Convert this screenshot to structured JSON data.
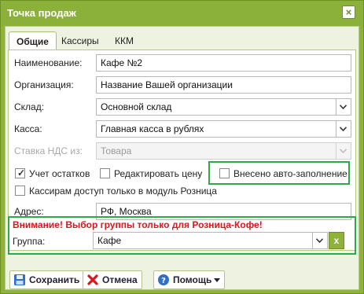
{
  "window": {
    "title": "Точка продаж"
  },
  "tabs": [
    {
      "label": "Общие",
      "active": true
    },
    {
      "label": "Кассиры",
      "active": false
    },
    {
      "label": "ККМ",
      "active": false
    }
  ],
  "form": {
    "name": {
      "label": "Наименование:",
      "value": "Кафе №2"
    },
    "organization": {
      "label": "Организация:",
      "value": "Название Вашей организации"
    },
    "warehouse": {
      "label": "Склад:",
      "value": "Основной склад"
    },
    "cashbox": {
      "label": "Касса:",
      "value": "Главная касса в рублях"
    },
    "vat_source": {
      "label": "Ставка НДС из:",
      "value": "Товара",
      "disabled": true
    },
    "checkboxes": {
      "stock_accounting": {
        "label": "Учет остатков",
        "checked": true
      },
      "edit_price": {
        "label": "Редактировать цену",
        "checked": false
      },
      "autofill": {
        "label": "Внесено авто-заполнение",
        "checked": false
      },
      "retail_only": {
        "label": "Кассирам доступ только в модуль Розница",
        "checked": false
      }
    },
    "address": {
      "label": "Адрес:",
      "value": "РФ, Москва"
    }
  },
  "group_section": {
    "warning": "Внимание! Выбор группы только для Розница-Кофе!",
    "label": "Группа:",
    "value": "Кафе",
    "clear_label": "x"
  },
  "buttons": {
    "save": "Сохранить",
    "cancel": "Отмена",
    "help": "Помощь"
  },
  "colors": {
    "accent": "#8fb33a",
    "highlight": "#2da84a",
    "warning": "#d6181f"
  }
}
